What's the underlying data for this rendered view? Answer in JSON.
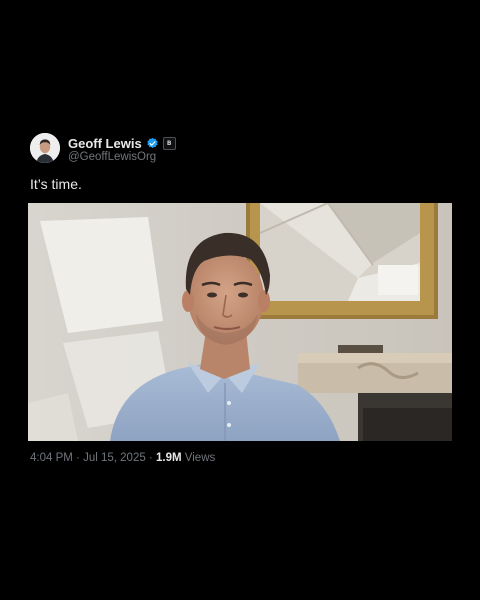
{
  "author": {
    "display_name": "Geoff Lewis",
    "handle": "@GeoffLewisOrg",
    "verified": true,
    "verified_icon": "verified-badge-icon",
    "affiliation_badge": "B"
  },
  "tweet": {
    "text": "It’s time.",
    "time": "4:04 PM",
    "sep1": "·",
    "date": "Jul 15, 2025",
    "sep2": "·",
    "views_count": "1.9M",
    "views_label": "Views"
  },
  "colors": {
    "background": "#000000",
    "text": "#e7e9ea",
    "muted": "#71767b",
    "verified_blue": "#1d9bf0"
  }
}
